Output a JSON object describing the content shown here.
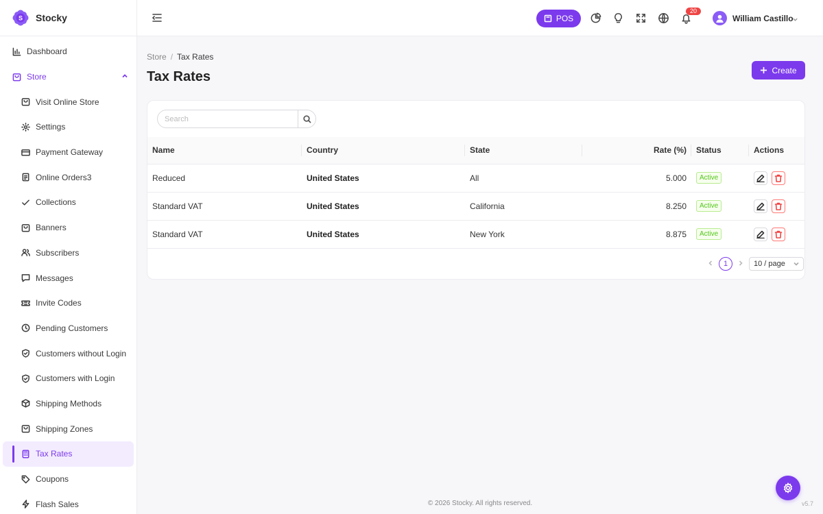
{
  "brand": {
    "name": "Stocky",
    "logo_letter": "S"
  },
  "sidebar": {
    "items": [
      {
        "label": "Dashboard",
        "icon": "chart-bar-icon"
      },
      {
        "label": "Store",
        "icon": "store-bag-icon",
        "expanded": true
      },
      {
        "label": "Visit Online Store",
        "icon": "bag-icon"
      },
      {
        "label": "Settings",
        "icon": "gear-icon"
      },
      {
        "label": "Payment Gateway",
        "icon": "credit-card-icon"
      },
      {
        "label": "Online Orders3",
        "icon": "receipt-icon"
      },
      {
        "label": "Collections",
        "icon": "check-icon"
      },
      {
        "label": "Banners",
        "icon": "bag-icon"
      },
      {
        "label": "Subscribers",
        "icon": "users-icon"
      },
      {
        "label": "Messages",
        "icon": "message-icon"
      },
      {
        "label": "Invite Codes",
        "icon": "ticket-icon"
      },
      {
        "label": "Pending Customers",
        "icon": "clock-icon"
      },
      {
        "label": "Customers without Login",
        "icon": "shield-icon"
      },
      {
        "label": "Customers with Login",
        "icon": "shield-check-icon"
      },
      {
        "label": "Shipping Methods",
        "icon": "box-icon"
      },
      {
        "label": "Shipping Zones",
        "icon": "bag-icon"
      },
      {
        "label": "Tax Rates",
        "icon": "calculator-icon",
        "active": true
      },
      {
        "label": "Coupons",
        "icon": "tag-icon"
      },
      {
        "label": "Flash Sales",
        "icon": "lightning-icon"
      }
    ]
  },
  "topbar": {
    "pos_label": "POS",
    "notification_count": "20",
    "user_name": "William Castillo"
  },
  "breadcrumb": {
    "parent": "Store",
    "separator": "/",
    "current": "Tax Rates"
  },
  "page": {
    "title": "Tax Rates",
    "create_label": "Create"
  },
  "search": {
    "placeholder": "Search"
  },
  "table": {
    "columns": [
      "Name",
      "Country",
      "State",
      "Rate (%)",
      "Status",
      "Actions"
    ],
    "rows": [
      {
        "name": "Reduced",
        "country": "United States",
        "state": "All",
        "rate": "5.000",
        "status": "Active"
      },
      {
        "name": "Standard VAT",
        "country": "United States",
        "state": "California",
        "rate": "8.250",
        "status": "Active"
      },
      {
        "name": "Standard VAT",
        "country": "United States",
        "state": "New York",
        "rate": "8.875",
        "status": "Active"
      }
    ]
  },
  "pagination": {
    "current_page": "1",
    "page_size": "10 / page"
  },
  "footer": {
    "copyright": "© 2026 Stocky. All rights reserved.",
    "version": "v5.7"
  },
  "colors": {
    "accent": "#7c3aed",
    "active_tag": "#52c41a",
    "danger": "#ef4444"
  }
}
